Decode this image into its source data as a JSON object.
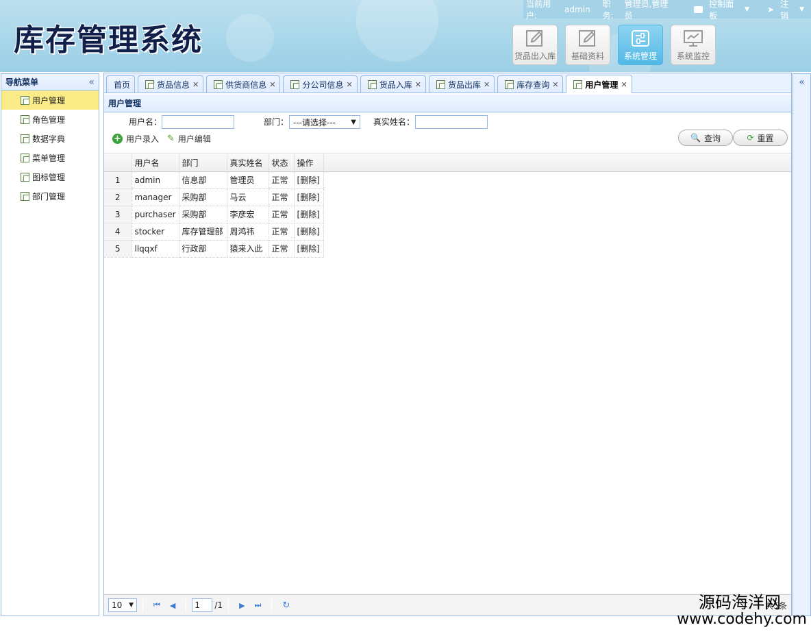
{
  "header": {
    "logo": "库存管理系统",
    "current_user_label": "当前用户:",
    "current_user": "admin",
    "role_label": "职务:",
    "role": "管理员,管理员",
    "control_panel": "控制面板",
    "logout": "注销"
  },
  "modules": [
    {
      "label": "货品出入库",
      "active": false
    },
    {
      "label": "基础资料",
      "active": false
    },
    {
      "label": "系统管理",
      "active": true
    },
    {
      "label": "系统监控",
      "active": false
    }
  ],
  "sidebar": {
    "title": "导航菜单",
    "items": [
      {
        "label": "用户管理",
        "active": true
      },
      {
        "label": "角色管理",
        "active": false
      },
      {
        "label": "数据字典",
        "active": false
      },
      {
        "label": "菜单管理",
        "active": false
      },
      {
        "label": "图标管理",
        "active": false
      },
      {
        "label": "部门管理",
        "active": false
      }
    ]
  },
  "tabs": [
    {
      "label": "首页",
      "closable": false
    },
    {
      "label": "货品信息",
      "closable": true
    },
    {
      "label": "供货商信息",
      "closable": true
    },
    {
      "label": "分公司信息",
      "closable": true
    },
    {
      "label": "货品入库",
      "closable": true
    },
    {
      "label": "货品出库",
      "closable": true
    },
    {
      "label": "库存查询",
      "closable": true
    },
    {
      "label": "用户管理",
      "closable": true,
      "active": true
    }
  ],
  "panel": {
    "title": "用户管理",
    "search": {
      "username_label": "用户名：",
      "username_value": "",
      "dept_label": "部门：",
      "dept_selected": "---请选择---",
      "realname_label": "真实姓名：",
      "realname_value": ""
    },
    "toolbar": {
      "add_label": "用户录入",
      "edit_label": "用户编辑",
      "query_label": "查询",
      "reset_label": "重置"
    },
    "table": {
      "columns": [
        "用户名",
        "部门",
        "真实姓名",
        "状态",
        "操作"
      ],
      "rows": [
        {
          "no": "1",
          "username": "admin",
          "dept": "信息部",
          "realname": "管理员",
          "status": "正常",
          "action": "[删除]"
        },
        {
          "no": "2",
          "username": "manager",
          "dept": "采购部",
          "realname": "马云",
          "status": "正常",
          "action": "[删除]"
        },
        {
          "no": "3",
          "username": "purchaser",
          "dept": "采购部",
          "realname": "李彦宏",
          "status": "正常",
          "action": "[删除]"
        },
        {
          "no": "4",
          "username": "stocker",
          "dept": "库存管理部",
          "realname": "周鸿祎",
          "status": "正常",
          "action": "[删除]"
        },
        {
          "no": "5",
          "username": "llqqxf",
          "dept": "行政部",
          "realname": "猿来入此",
          "status": "正常",
          "action": "[删除]"
        }
      ]
    },
    "pager": {
      "page_size": "10",
      "current_page": "1",
      "total_pages": "/1",
      "info": "共5条"
    }
  },
  "watermark": {
    "line1": "源码海洋网",
    "line2": "www.codehy.com"
  },
  "colors": {
    "header_bg": "#a7d6ea",
    "accent_border": "#95b8e7",
    "active_sidebar": "#fbec88",
    "active_module": "#52b8e6"
  }
}
